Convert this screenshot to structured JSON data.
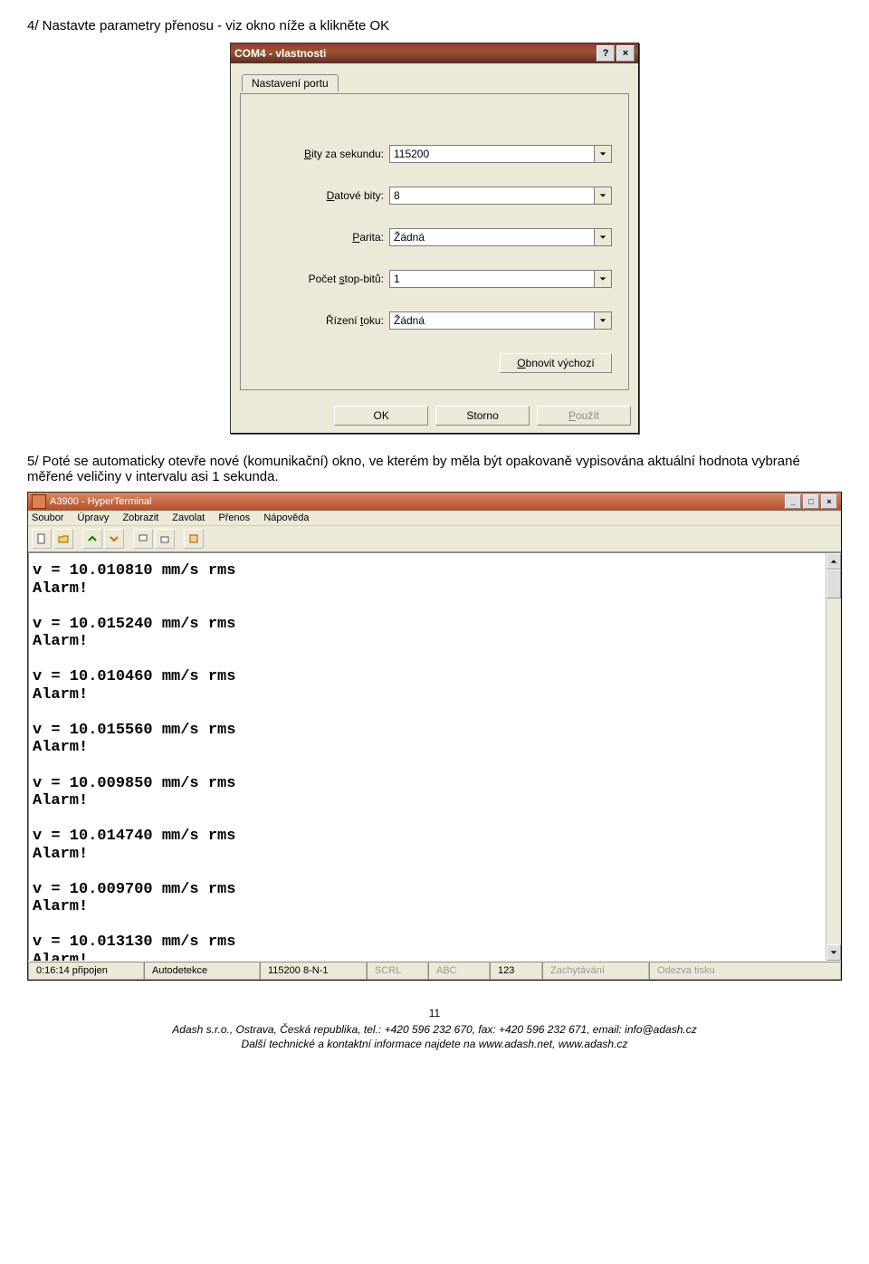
{
  "instructions": {
    "step4": "4/  Nastavte parametry přenosu - viz okno níže a klikněte OK",
    "step5": "5/  Poté se automaticky otevře nové (komunikační) okno, ve kterém by měla být opakovaně vypisována aktuální hodnota vybrané měřené veličiny v intervalu asi 1 sekunda."
  },
  "dialog": {
    "title": "COM4 - vlastnosti",
    "tab": "Nastavení portu",
    "fields": {
      "baud_label": "Bity za sekundu:",
      "baud_value": "115200",
      "data_label": "Datové bity:",
      "data_value": "8",
      "parity_label": "Parita:",
      "parity_value": "Žádná",
      "stop_label": "Počet stop-bitů:",
      "stop_value": "1",
      "flow_label": "Řízení toku:",
      "flow_value": "Žádná"
    },
    "buttons": {
      "restore": "Obnovit výchozí",
      "ok": "OK",
      "cancel": "Storno",
      "apply": "Použít"
    }
  },
  "hyper": {
    "title": "A3900 - HyperTerminal",
    "menu": [
      "Soubor",
      "Úpravy",
      "Zobrazit",
      "Zavolat",
      "Přenos",
      "Nápověda"
    ],
    "lines": [
      "v = 10.010810 mm/s rms",
      "Alarm!",
      "",
      "v = 10.015240 mm/s rms",
      "Alarm!",
      "",
      "v = 10.010460 mm/s rms",
      "Alarm!",
      "",
      "v = 10.015560 mm/s rms",
      "Alarm!",
      "",
      "v = 10.009850 mm/s rms",
      "Alarm!",
      "",
      "v = 10.014740 mm/s rms",
      "Alarm!",
      "",
      "v = 10.009700 mm/s rms",
      "Alarm!",
      "",
      "v = 10.013130 mm/s rms",
      "Alarm!"
    ],
    "status": {
      "time": "0:16:14 připojen",
      "detect": "Autodetekce",
      "settings": "115200 8-N-1",
      "scrl": "SCRL",
      "abc": "ABC",
      "num": "123",
      "capture": "Zachytávání",
      "echo": "Odezva tisku"
    }
  },
  "footer": {
    "page": "11",
    "line1a": "Adash s.r.o., Ostrava, Česká republika, tel.: +420 596 232 670, fax: +420 596 232 671, email: ",
    "line1b": "info@adash.cz",
    "line2": "Další technické a kontaktní informace najdete na www.adash.net, www.adash.cz"
  }
}
